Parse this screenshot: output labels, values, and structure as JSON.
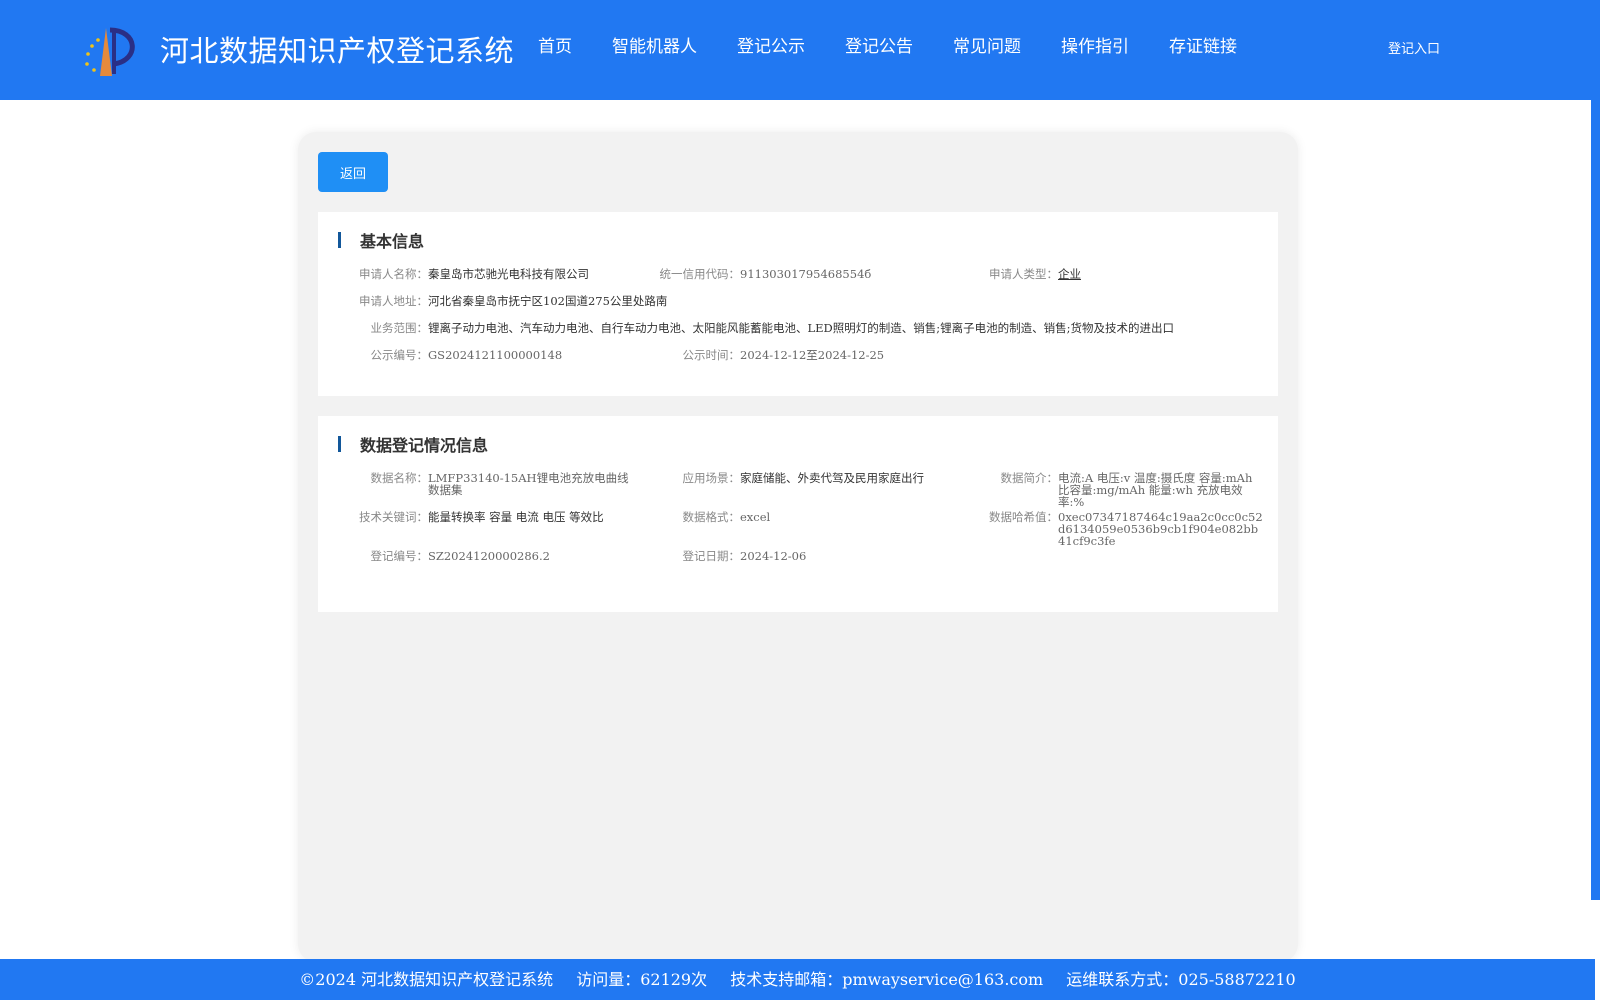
{
  "header": {
    "title": "河北数据知识产权登记系统",
    "nav": [
      "首页",
      "智能机器人",
      "登记公示",
      "登记公告",
      "常见问题",
      "操作指引",
      "存证链接"
    ],
    "login": "登记入口"
  },
  "back_label": "返回",
  "basic": {
    "title": "基本信息",
    "applicant_name_label": "申请人名称：",
    "applicant_name": "秦皇岛市芯驰光电科技有限公司",
    "credit_code_label": "统一信用代码：",
    "credit_code": "91130301795468554б",
    "applicant_type_label": "申请人类型：",
    "applicant_type": "企业",
    "address_label": "申请人地址：",
    "address": "河北省秦皇岛市抚宁区102国道275公里处路南",
    "scope_label": "业务范围：",
    "scope": "锂离子动力电池、汽车动力电池、自行车动力电池、太阳能风能蓄能电池、LED照明灯的制造、销售;锂离子电池的制造、销售;货物及技术的进出口",
    "notice_no_label": "公示编号：",
    "notice_no": "GS2024121100000148",
    "notice_time_label": "公示时间：",
    "notice_time": "2024-12-12至2024-12-25"
  },
  "register": {
    "title": "数据登记情况信息",
    "data_name_label": "数据名称：",
    "data_name": "LMFP33140-15AH锂电池充放电曲线数据集",
    "scenario_label": "应用场景：",
    "scenario": "家庭储能、外卖代驾及民用家庭出行",
    "summary_label": "数据简介：",
    "summary": "电流:A 电压:v 温度:摄氏度 容量:mAh 比容量:mg/mAh 能量:wh 充放电效率:%",
    "keywords_label": "技术关键词：",
    "keywords": "能量转换率 容量 电流 电压 等效比",
    "format_label": "数据格式：",
    "format": "excel",
    "hash_label": "数据哈希值：",
    "hash": "0xec07347187464c19aa2c0cc0c52d6134059e0536b9cb1f904e082bb41cf9c3fe",
    "reg_no_label": "登记编号：",
    "reg_no": "SZ2024120000286.2",
    "reg_date_label": "登记日期：",
    "reg_date": "2024-12-06"
  },
  "footer": {
    "copyright": "©2024 河北数据知识产权登记系统",
    "visits": "访问量：62129次",
    "email": "技术支持邮箱：pmwayservice@163.com",
    "phone": "运维联系方式：025-58872210"
  },
  "colors": {
    "primary": "#2178f2",
    "button": "#1f8ff5",
    "accent_bar": "#12579a"
  }
}
